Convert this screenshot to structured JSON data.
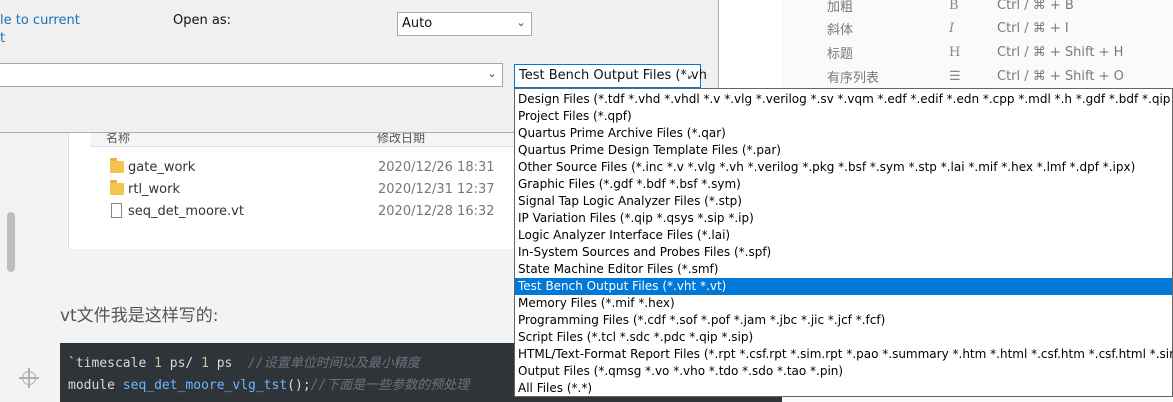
{
  "dialog": {
    "link_text": "le to current\nt",
    "open_as_label": "Open as:",
    "open_as_value": "Auto",
    "filename_value": "",
    "filter_value": "Test Bench Output Files (*.vh"
  },
  "file_types": [
    "Design Files (*.tdf *.vhd *.vhdl *.v *.vlg *.verilog *.sv *.vqm *.edf *.edif *.edn *.cpp *.mdl *.h *.gdf *.bdf *.qip *.qdb *",
    "Project Files (*.qpf)",
    "Quartus Prime Archive Files (*.qar)",
    "Quartus Prime Design Template Files (*.par)",
    "Other Source Files (*.inc *.v *.vlg *.vh *.verilog *.pkg *.bsf *.sym *.stp *.lai *.mif *.hex *.lmf *.dpf *.ipx)",
    "Graphic Files (*.gdf *.bdf *.bsf *.sym)",
    "Signal Tap Logic Analyzer Files (*.stp)",
    "IP Variation Files (*.qip *.qsys *.sip *.ip)",
    "Logic Analyzer Interface Files (*.lai)",
    "In-System Sources and Probes Files (*.spf)",
    "State Machine Editor Files (*.smf)",
    "Test Bench Output Files (*.vht *.vt)",
    "Memory Files (*.mif *.hex)",
    "Programming Files (*.cdf *.sof *.pof *.jam *.jbc *.jic *.jcf *.fcf)",
    "Script Files (*.tcl *.sdc *.pdc *.qip *.sip)",
    "HTML/Text-Format Report Files (*.rpt *.csf.rpt *.sim.rpt *.pao *.summary *.htm *.html *.csf.htm *.csf.html *.sim.htm",
    "Output Files (*.qmsg *.vo *.vho *.tdo *.sdo *.tao *.pin)",
    "All Files (*.*)"
  ],
  "selected_index": 11,
  "shortcuts": [
    {
      "name": "加粗",
      "icon": "B",
      "keys": "Ctrl / ⌘ + B"
    },
    {
      "name": "斜体",
      "icon": "I",
      "keys": "Ctrl / ⌘ + I"
    },
    {
      "name": "标题",
      "icon": "H",
      "keys": "Ctrl / ⌘ + Shift + H"
    },
    {
      "name": "有序列表",
      "icon": "☰",
      "keys": "Ctrl / ⌘ + Shift + O"
    }
  ],
  "explorer": {
    "col_name": "名称",
    "col_date": "修改日期",
    "files": [
      {
        "name": "gate_work",
        "date": "2020/12/26 18:31",
        "kind": "folder"
      },
      {
        "name": "rtl_work",
        "date": "2020/12/31 12:37",
        "kind": "folder"
      },
      {
        "name": "seq_det_moore.vt",
        "date": "2020/12/28 16:32",
        "kind": "file"
      }
    ]
  },
  "article": {
    "vt_text": "vt文件我是这样写的:"
  },
  "code": {
    "line1_kw": "`timescale",
    "line1_n1": "1",
    "line1_mid": " ps/ ",
    "line1_n2": "1",
    "line1_unit": " ps",
    "line1_comment": "//设置单位时间以及最小精度",
    "line2_kw": "module ",
    "line2_ident": "seq_det_moore_vlg_tst",
    "line2_punct": "();",
    "line2_comment": "//下面是一些参数的预处理"
  },
  "colors": {
    "accent": "#0078d7",
    "link": "#1a6fb5",
    "code_bg": "#2f3439"
  }
}
